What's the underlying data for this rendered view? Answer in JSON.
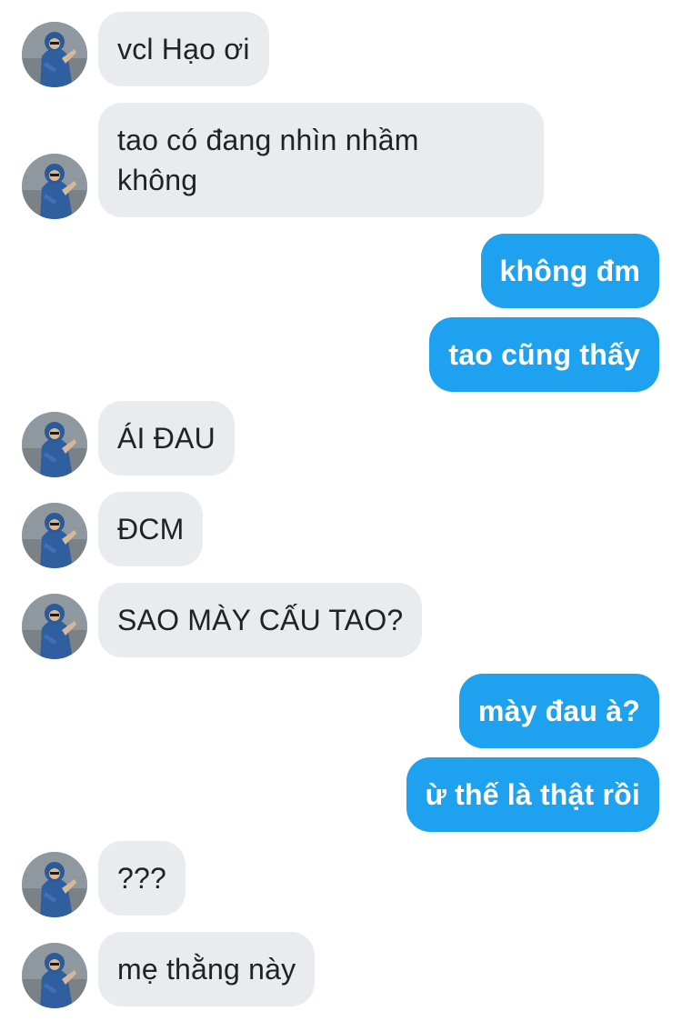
{
  "conversation": {
    "messages": [
      {
        "id": "m1",
        "side": "in",
        "text": "vcl Hạo ơi",
        "avatar": "person-avatar"
      },
      {
        "id": "m2",
        "side": "in",
        "text": "tao có đang nhìn nhầm không",
        "avatar": "person-avatar"
      },
      {
        "id": "m3",
        "side": "out",
        "text": "không đm"
      },
      {
        "id": "m4",
        "side": "out",
        "text": "tao cũng thấy"
      },
      {
        "id": "m5",
        "side": "in",
        "text": "ÁI ĐAU",
        "avatar": "person-avatar"
      },
      {
        "id": "m6",
        "side": "in",
        "text": "ĐCM",
        "avatar": "person-avatar"
      },
      {
        "id": "m7",
        "side": "in",
        "text": "SAO MÀY CẤU TAO?",
        "avatar": "person-avatar"
      },
      {
        "id": "m8",
        "side": "out",
        "text": "mày đau à?"
      },
      {
        "id": "m9",
        "side": "out",
        "text": "ừ thế là thật rồi"
      },
      {
        "id": "m10",
        "side": "in",
        "text": "???",
        "avatar": "person-avatar"
      },
      {
        "id": "m11",
        "side": "in",
        "text": "mẹ thằng này",
        "avatar": "person-avatar"
      }
    ]
  },
  "colors": {
    "incoming_bubble": "#e9ebee",
    "outgoing_bubble": "#1ea1ef",
    "incoming_text": "#222222",
    "outgoing_text": "#ffffff"
  }
}
